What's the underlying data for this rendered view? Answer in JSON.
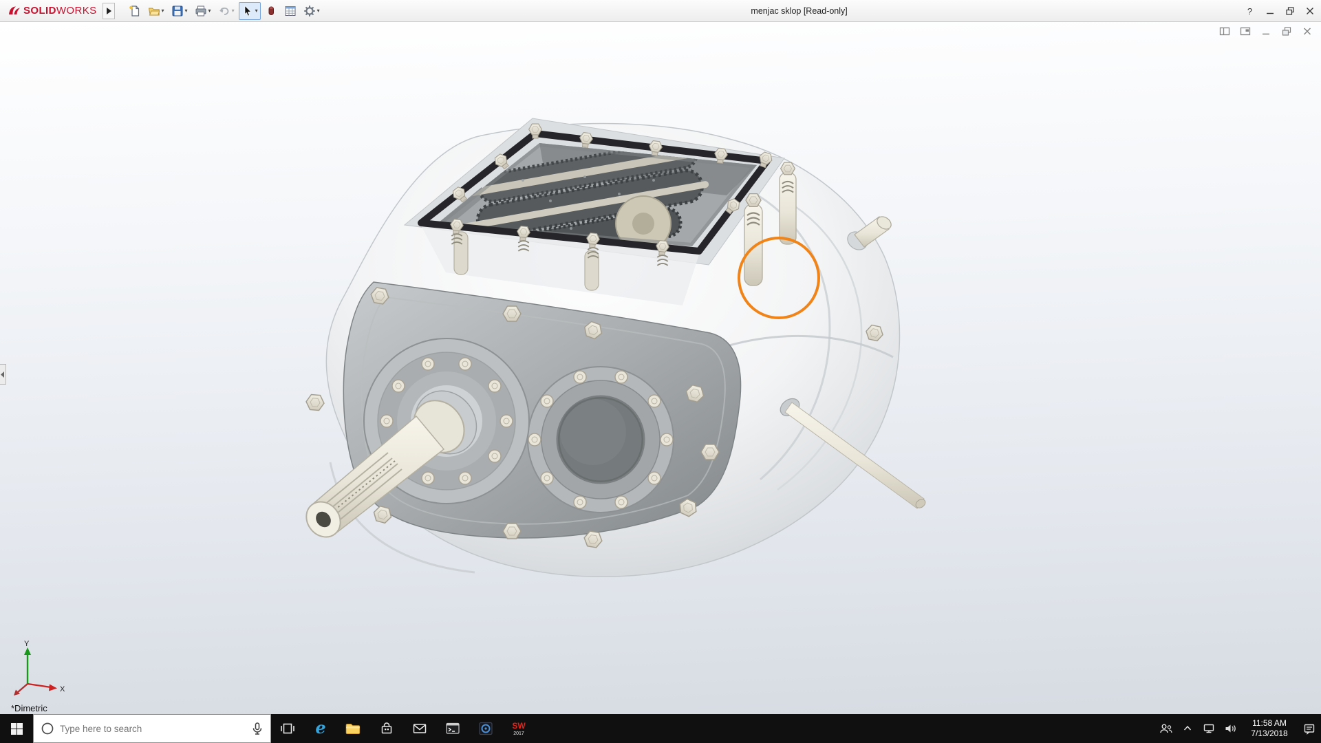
{
  "titlebar": {
    "brand": {
      "bold": "SOLID",
      "light": "WORKS"
    },
    "document_title": "menjac sklop [Read-only]",
    "help_label": "?",
    "toolbar_icons": [
      {
        "name": "new-document"
      },
      {
        "name": "open",
        "caret": true
      },
      {
        "name": "save",
        "caret": true
      },
      {
        "name": "print",
        "caret": true
      },
      {
        "name": "undo",
        "caret": true,
        "disabled": true
      },
      {
        "name": "select",
        "caret": true,
        "active": true
      },
      {
        "name": "edit-appearance"
      },
      {
        "name": "design-table"
      },
      {
        "name": "options",
        "caret": true
      }
    ]
  },
  "document_controls": [
    "split-window",
    "new-window",
    "minimize",
    "restore",
    "close"
  ],
  "viewport": {
    "view_orientation_label": "*Dimetric",
    "annotation_color": "#f08418",
    "triad": {
      "x_label": "X",
      "y_label": "Y"
    }
  },
  "taskbar": {
    "search_placeholder": "Type here to search",
    "clock": {
      "time": "11:58 AM",
      "date": "7/13/2018"
    },
    "sw_badge": {
      "line1": "SW",
      "line2": "2017"
    },
    "edge_glyph": "e",
    "pinned_apps": [
      "task-view",
      "edge",
      "file-explorer",
      "store",
      "mail",
      "console",
      "media-app",
      "solidworks-2017"
    ],
    "tray_icons": [
      "people",
      "chevron-up",
      "network",
      "volume",
      "action-center"
    ]
  },
  "colors": {
    "brand_red": "#c8102e",
    "taskbar_background": "#101010",
    "annotation_orange": "#f08418",
    "viewport_gradient_top": "#ffffff",
    "viewport_gradient_bottom": "#d6dbe2"
  }
}
